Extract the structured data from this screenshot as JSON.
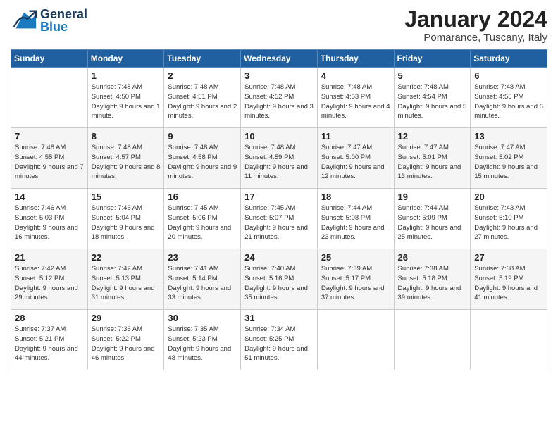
{
  "header": {
    "logo_general": "General",
    "logo_blue": "Blue",
    "month": "January 2024",
    "location": "Pomarance, Tuscany, Italy"
  },
  "weekdays": [
    "Sunday",
    "Monday",
    "Tuesday",
    "Wednesday",
    "Thursday",
    "Friday",
    "Saturday"
  ],
  "weeks": [
    [
      {
        "num": "",
        "sunrise": "",
        "sunset": "",
        "daylight": ""
      },
      {
        "num": "1",
        "sunrise": "Sunrise: 7:48 AM",
        "sunset": "Sunset: 4:50 PM",
        "daylight": "Daylight: 9 hours and 1 minute."
      },
      {
        "num": "2",
        "sunrise": "Sunrise: 7:48 AM",
        "sunset": "Sunset: 4:51 PM",
        "daylight": "Daylight: 9 hours and 2 minutes."
      },
      {
        "num": "3",
        "sunrise": "Sunrise: 7:48 AM",
        "sunset": "Sunset: 4:52 PM",
        "daylight": "Daylight: 9 hours and 3 minutes."
      },
      {
        "num": "4",
        "sunrise": "Sunrise: 7:48 AM",
        "sunset": "Sunset: 4:53 PM",
        "daylight": "Daylight: 9 hours and 4 minutes."
      },
      {
        "num": "5",
        "sunrise": "Sunrise: 7:48 AM",
        "sunset": "Sunset: 4:54 PM",
        "daylight": "Daylight: 9 hours and 5 minutes."
      },
      {
        "num": "6",
        "sunrise": "Sunrise: 7:48 AM",
        "sunset": "Sunset: 4:55 PM",
        "daylight": "Daylight: 9 hours and 6 minutes."
      }
    ],
    [
      {
        "num": "7",
        "sunrise": "Sunrise: 7:48 AM",
        "sunset": "Sunset: 4:55 PM",
        "daylight": "Daylight: 9 hours and 7 minutes."
      },
      {
        "num": "8",
        "sunrise": "Sunrise: 7:48 AM",
        "sunset": "Sunset: 4:57 PM",
        "daylight": "Daylight: 9 hours and 8 minutes."
      },
      {
        "num": "9",
        "sunrise": "Sunrise: 7:48 AM",
        "sunset": "Sunset: 4:58 PM",
        "daylight": "Daylight: 9 hours and 9 minutes."
      },
      {
        "num": "10",
        "sunrise": "Sunrise: 7:48 AM",
        "sunset": "Sunset: 4:59 PM",
        "daylight": "Daylight: 9 hours and 11 minutes."
      },
      {
        "num": "11",
        "sunrise": "Sunrise: 7:47 AM",
        "sunset": "Sunset: 5:00 PM",
        "daylight": "Daylight: 9 hours and 12 minutes."
      },
      {
        "num": "12",
        "sunrise": "Sunrise: 7:47 AM",
        "sunset": "Sunset: 5:01 PM",
        "daylight": "Daylight: 9 hours and 13 minutes."
      },
      {
        "num": "13",
        "sunrise": "Sunrise: 7:47 AM",
        "sunset": "Sunset: 5:02 PM",
        "daylight": "Daylight: 9 hours and 15 minutes."
      }
    ],
    [
      {
        "num": "14",
        "sunrise": "Sunrise: 7:46 AM",
        "sunset": "Sunset: 5:03 PM",
        "daylight": "Daylight: 9 hours and 16 minutes."
      },
      {
        "num": "15",
        "sunrise": "Sunrise: 7:46 AM",
        "sunset": "Sunset: 5:04 PM",
        "daylight": "Daylight: 9 hours and 18 minutes."
      },
      {
        "num": "16",
        "sunrise": "Sunrise: 7:45 AM",
        "sunset": "Sunset: 5:06 PM",
        "daylight": "Daylight: 9 hours and 20 minutes."
      },
      {
        "num": "17",
        "sunrise": "Sunrise: 7:45 AM",
        "sunset": "Sunset: 5:07 PM",
        "daylight": "Daylight: 9 hours and 21 minutes."
      },
      {
        "num": "18",
        "sunrise": "Sunrise: 7:44 AM",
        "sunset": "Sunset: 5:08 PM",
        "daylight": "Daylight: 9 hours and 23 minutes."
      },
      {
        "num": "19",
        "sunrise": "Sunrise: 7:44 AM",
        "sunset": "Sunset: 5:09 PM",
        "daylight": "Daylight: 9 hours and 25 minutes."
      },
      {
        "num": "20",
        "sunrise": "Sunrise: 7:43 AM",
        "sunset": "Sunset: 5:10 PM",
        "daylight": "Daylight: 9 hours and 27 minutes."
      }
    ],
    [
      {
        "num": "21",
        "sunrise": "Sunrise: 7:42 AM",
        "sunset": "Sunset: 5:12 PM",
        "daylight": "Daylight: 9 hours and 29 minutes."
      },
      {
        "num": "22",
        "sunrise": "Sunrise: 7:42 AM",
        "sunset": "Sunset: 5:13 PM",
        "daylight": "Daylight: 9 hours and 31 minutes."
      },
      {
        "num": "23",
        "sunrise": "Sunrise: 7:41 AM",
        "sunset": "Sunset: 5:14 PM",
        "daylight": "Daylight: 9 hours and 33 minutes."
      },
      {
        "num": "24",
        "sunrise": "Sunrise: 7:40 AM",
        "sunset": "Sunset: 5:16 PM",
        "daylight": "Daylight: 9 hours and 35 minutes."
      },
      {
        "num": "25",
        "sunrise": "Sunrise: 7:39 AM",
        "sunset": "Sunset: 5:17 PM",
        "daylight": "Daylight: 9 hours and 37 minutes."
      },
      {
        "num": "26",
        "sunrise": "Sunrise: 7:38 AM",
        "sunset": "Sunset: 5:18 PM",
        "daylight": "Daylight: 9 hours and 39 minutes."
      },
      {
        "num": "27",
        "sunrise": "Sunrise: 7:38 AM",
        "sunset": "Sunset: 5:19 PM",
        "daylight": "Daylight: 9 hours and 41 minutes."
      }
    ],
    [
      {
        "num": "28",
        "sunrise": "Sunrise: 7:37 AM",
        "sunset": "Sunset: 5:21 PM",
        "daylight": "Daylight: 9 hours and 44 minutes."
      },
      {
        "num": "29",
        "sunrise": "Sunrise: 7:36 AM",
        "sunset": "Sunset: 5:22 PM",
        "daylight": "Daylight: 9 hours and 46 minutes."
      },
      {
        "num": "30",
        "sunrise": "Sunrise: 7:35 AM",
        "sunset": "Sunset: 5:23 PM",
        "daylight": "Daylight: 9 hours and 48 minutes."
      },
      {
        "num": "31",
        "sunrise": "Sunrise: 7:34 AM",
        "sunset": "Sunset: 5:25 PM",
        "daylight": "Daylight: 9 hours and 51 minutes."
      },
      {
        "num": "",
        "sunrise": "",
        "sunset": "",
        "daylight": ""
      },
      {
        "num": "",
        "sunrise": "",
        "sunset": "",
        "daylight": ""
      },
      {
        "num": "",
        "sunrise": "",
        "sunset": "",
        "daylight": ""
      }
    ]
  ]
}
